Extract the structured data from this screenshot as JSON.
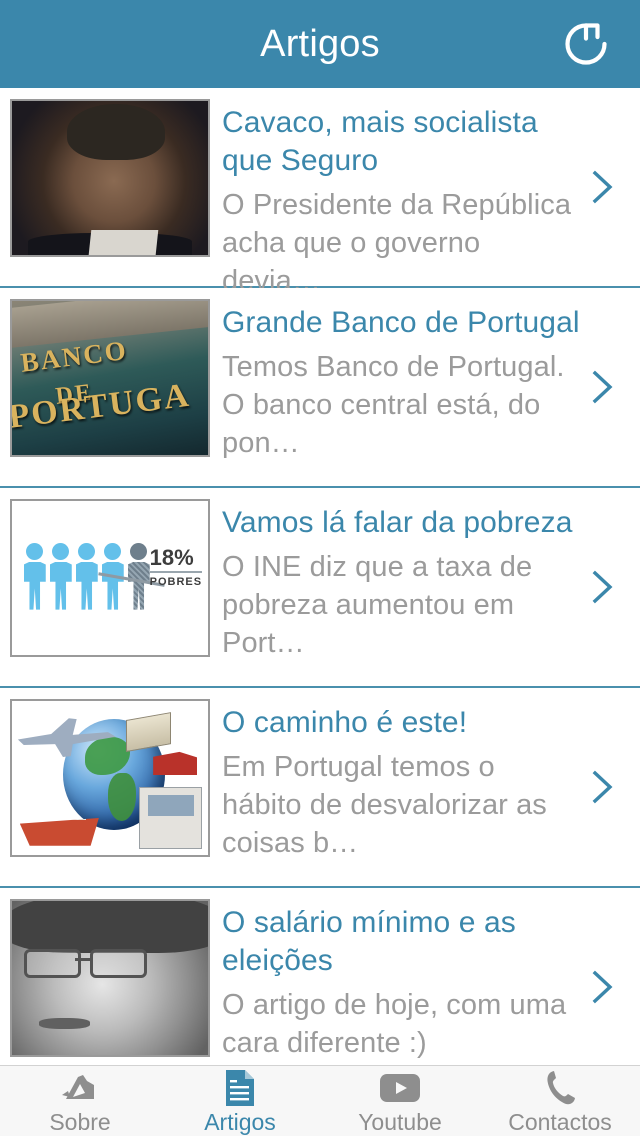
{
  "theme": {
    "accent": "#3b87ab",
    "nav_bg": "#3b87ab",
    "nav_text": "#ffffff",
    "title_color": "#3b87ab",
    "subtitle_color": "#9b9b9b",
    "separator": "#4a90ad",
    "tabbar_bg": "#f7f7f7",
    "tab_inactive": "#8e8e8e",
    "tab_active": "#3b87ab"
  },
  "navbar": {
    "title": "Artigos",
    "refresh_icon": "refresh-icon"
  },
  "list": {
    "items": [
      {
        "title": "Cavaco, mais socialista que Seguro",
        "subtitle": "O Presidente da República acha que o governo devia…",
        "thumb": "portrait-cavaco-photo",
        "chevron": "chevron-right-icon"
      },
      {
        "title": "Grande Banco de Portugal",
        "subtitle": "Temos Banco de Portugal. O banco central está, do pon…",
        "thumb": "banco-de-portugal-sign-photo",
        "thumb_text": [
          "BANCO",
          "DE",
          "PORTUGA"
        ],
        "chevron": "chevron-right-icon"
      },
      {
        "title": "Vamos lá falar da pobreza",
        "subtitle": "O INE diz que a taxa de pobreza aumentou em Port…",
        "thumb": "poverty-infographic",
        "thumb_percent": "18%",
        "thumb_caption": "POBRES",
        "chevron": "chevron-right-icon"
      },
      {
        "title": "O caminho é este!",
        "subtitle": "Em Portugal temos o hábito de desvalorizar as coisas b…",
        "thumb": "global-logistics-collage",
        "chevron": "chevron-right-icon"
      },
      {
        "title": "O salário mínimo e as eleições",
        "subtitle": "O artigo de hoje, com uma cara diferente :)",
        "thumb": "bw-portrait-photo",
        "chevron": "chevron-right-icon"
      }
    ]
  },
  "tabbar": {
    "tabs": [
      {
        "label": "Sobre",
        "icon": "about-logo-icon",
        "active": false
      },
      {
        "label": "Artigos",
        "icon": "document-icon",
        "active": true
      },
      {
        "label": "Youtube",
        "icon": "youtube-play-icon",
        "active": false
      },
      {
        "label": "Contactos",
        "icon": "phone-icon",
        "active": false
      }
    ]
  }
}
